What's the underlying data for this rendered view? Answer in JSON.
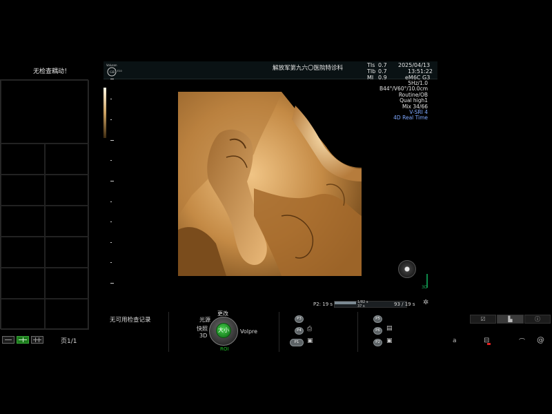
{
  "left_panel": {
    "message": "无检查耦动！",
    "page_label": "页1/1"
  },
  "header": {
    "hospital": "解放军第九六〇医院特诊科",
    "tis_label": "TIs",
    "tis_value": "0.7",
    "tib_label": "TIb",
    "tib_value": "0.7",
    "mi_label": "MI",
    "mi_value": "0.9",
    "date": "2025/04/13",
    "time": "13:51:22",
    "probe": "eM6C G3",
    "logo_text": "Voluson",
    "logo_sub": "E10"
  },
  "params": {
    "freq": "5Hz/1.0",
    "angle": "B44°/V60°/10.0cm",
    "preset": "Routine/OB",
    "quality": "Qual high1",
    "mix": "Mix 34/66",
    "vsri": "V-SRI 4",
    "mode": "4D Real Time"
  },
  "orientation": {
    "axis_label": "3D"
  },
  "cine": {
    "left_label": "P2:",
    "left_count": "19 s",
    "bar_top": "1/82 s",
    "bar_bottom": "37 s",
    "right_label": "93 / 19 s",
    "fill_fraction": 0.3
  },
  "bottom_panel": {
    "no_records": "无可用检查记录",
    "knob": {
      "top": "更改",
      "upper_left": "光源",
      "left1": "快照",
      "left2": "3D",
      "right": "Volpre",
      "center": "大小",
      "bottom": "ROI"
    },
    "group1": {
      "p3": "P3",
      "p4": "P4",
      "p1": "P1"
    },
    "group2": {
      "p5": "P5",
      "p6": "P6",
      "p2": "P2"
    }
  },
  "right_tabs": [
    "☑",
    "▙",
    "ⓘ"
  ],
  "status": {
    "letter": "a",
    "net_icon": "network-icon",
    "wifi_icon": "wifi-icon",
    "at_icon": "at-icon"
  },
  "colors": {
    "accent_green": "#1c7b1c",
    "param_blue": "#7fa8ff",
    "render_tone": "#c48a45"
  }
}
